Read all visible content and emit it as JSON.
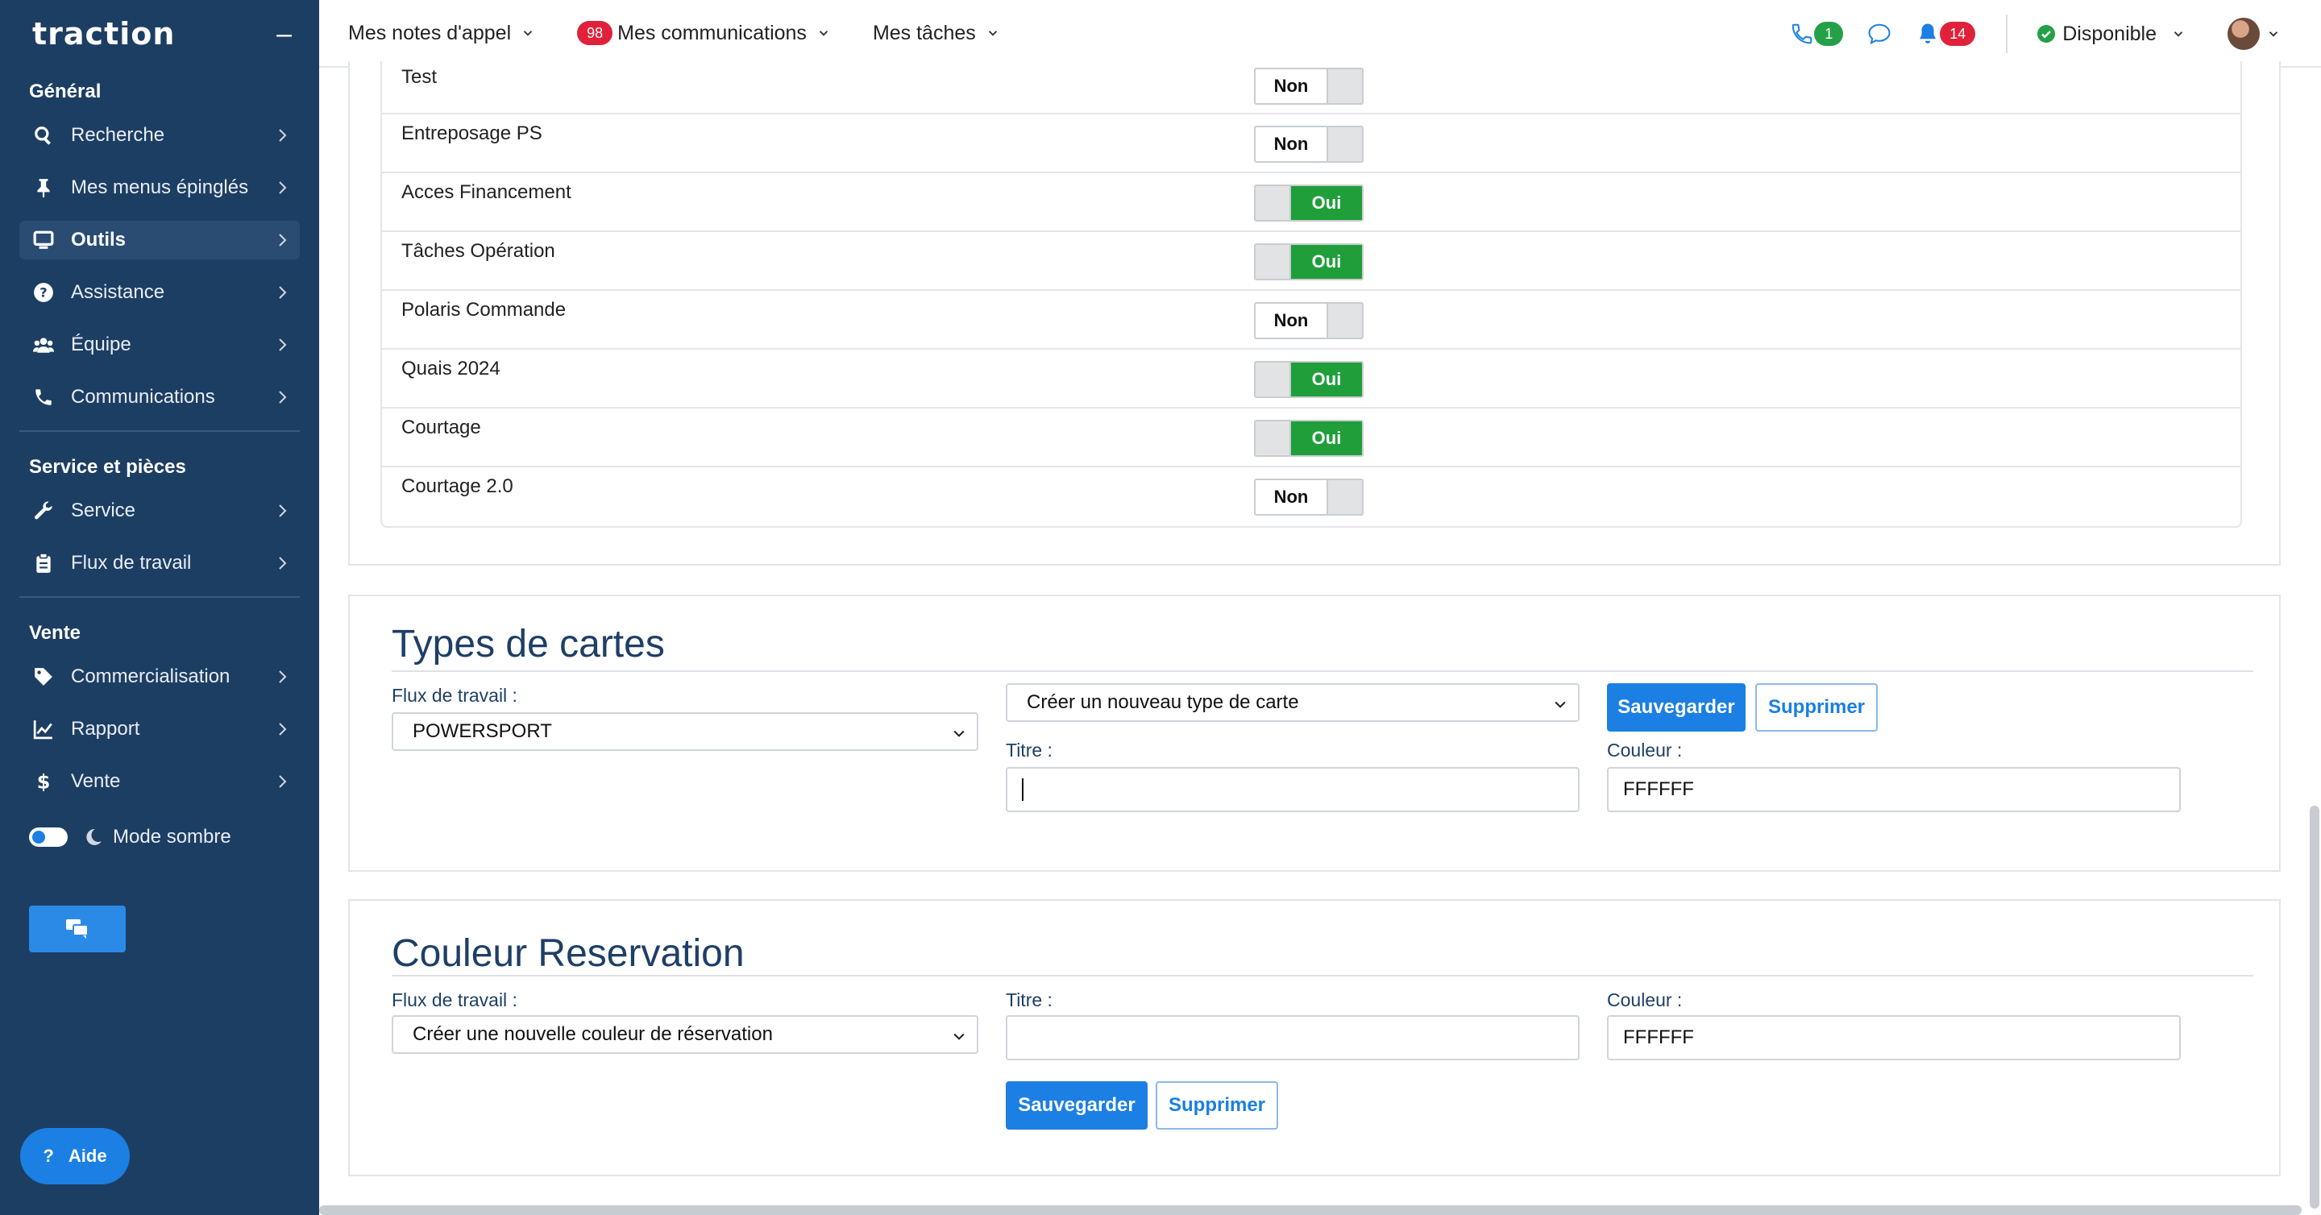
{
  "app": {
    "logo": "traction"
  },
  "sidebar": {
    "sections": [
      {
        "title": "Général",
        "items": [
          {
            "label": "Recherche",
            "icon": "search-icon"
          },
          {
            "label": "Mes menus épinglés",
            "icon": "pin-icon"
          },
          {
            "label": "Outils",
            "icon": "monitor-icon",
            "active": true
          },
          {
            "label": "Assistance",
            "icon": "question-icon"
          },
          {
            "label": "Équipe",
            "icon": "users-icon"
          },
          {
            "label": "Communications",
            "icon": "phone-icon"
          }
        ]
      },
      {
        "title": "Service et pièces",
        "items": [
          {
            "label": "Service",
            "icon": "wrench-icon"
          },
          {
            "label": "Flux de travail",
            "icon": "clipboard-icon"
          }
        ]
      },
      {
        "title": "Vente",
        "items": [
          {
            "label": "Commercialisation",
            "icon": "tag-icon"
          },
          {
            "label": "Rapport",
            "icon": "chart-icon"
          },
          {
            "label": "Vente",
            "icon": "dollar-icon"
          }
        ]
      }
    ],
    "dark_mode_label": "Mode sombre",
    "help_label": "Aide"
  },
  "topbar": {
    "menu_call_notes": "Mes notes d'appel",
    "menu_communications": "Mes communications",
    "communications_badge": "98",
    "menu_tasks": "Mes tâches",
    "phone_badge": "1",
    "notifications_badge": "14",
    "status_label": "Disponible"
  },
  "toggles": [
    {
      "label": "Test",
      "state": "Non"
    },
    {
      "label": "Entreposage PS",
      "state": "Non"
    },
    {
      "label": "Acces Financement",
      "state": "Oui"
    },
    {
      "label": "Tâches Opération",
      "state": "Oui"
    },
    {
      "label": "Polaris Commande",
      "state": "Non"
    },
    {
      "label": "Quais 2024",
      "state": "Oui"
    },
    {
      "label": "Courtage",
      "state": "Oui"
    },
    {
      "label": "Courtage 2.0",
      "state": "Non"
    }
  ],
  "card_types": {
    "heading": "Types de cartes",
    "workflow_label": "Flux de travail :",
    "workflow_value": "POWERSPORT",
    "type_select_value": "Créer un nouveau type de carte",
    "save_label": "Sauvegarder",
    "delete_label": "Supprimer",
    "title_label": "Titre :",
    "title_value": "",
    "color_label": "Couleur :",
    "color_value": "FFFFFF"
  },
  "reservation_color": {
    "heading": "Couleur Reservation",
    "workflow_label": "Flux de travail :",
    "workflow_value": "Créer une nouvelle couleur de réservation",
    "title_label": "Titre :",
    "title_value": "",
    "color_label": "Couleur :",
    "color_value": "FFFFFF",
    "save_label": "Sauvegarder",
    "delete_label": "Supprimer"
  },
  "colors": {
    "sidebar_bg": "#1d3e63",
    "accent": "#1b7fe3",
    "on_green": "#1f9e3a",
    "badge_red": "#e0213a"
  }
}
